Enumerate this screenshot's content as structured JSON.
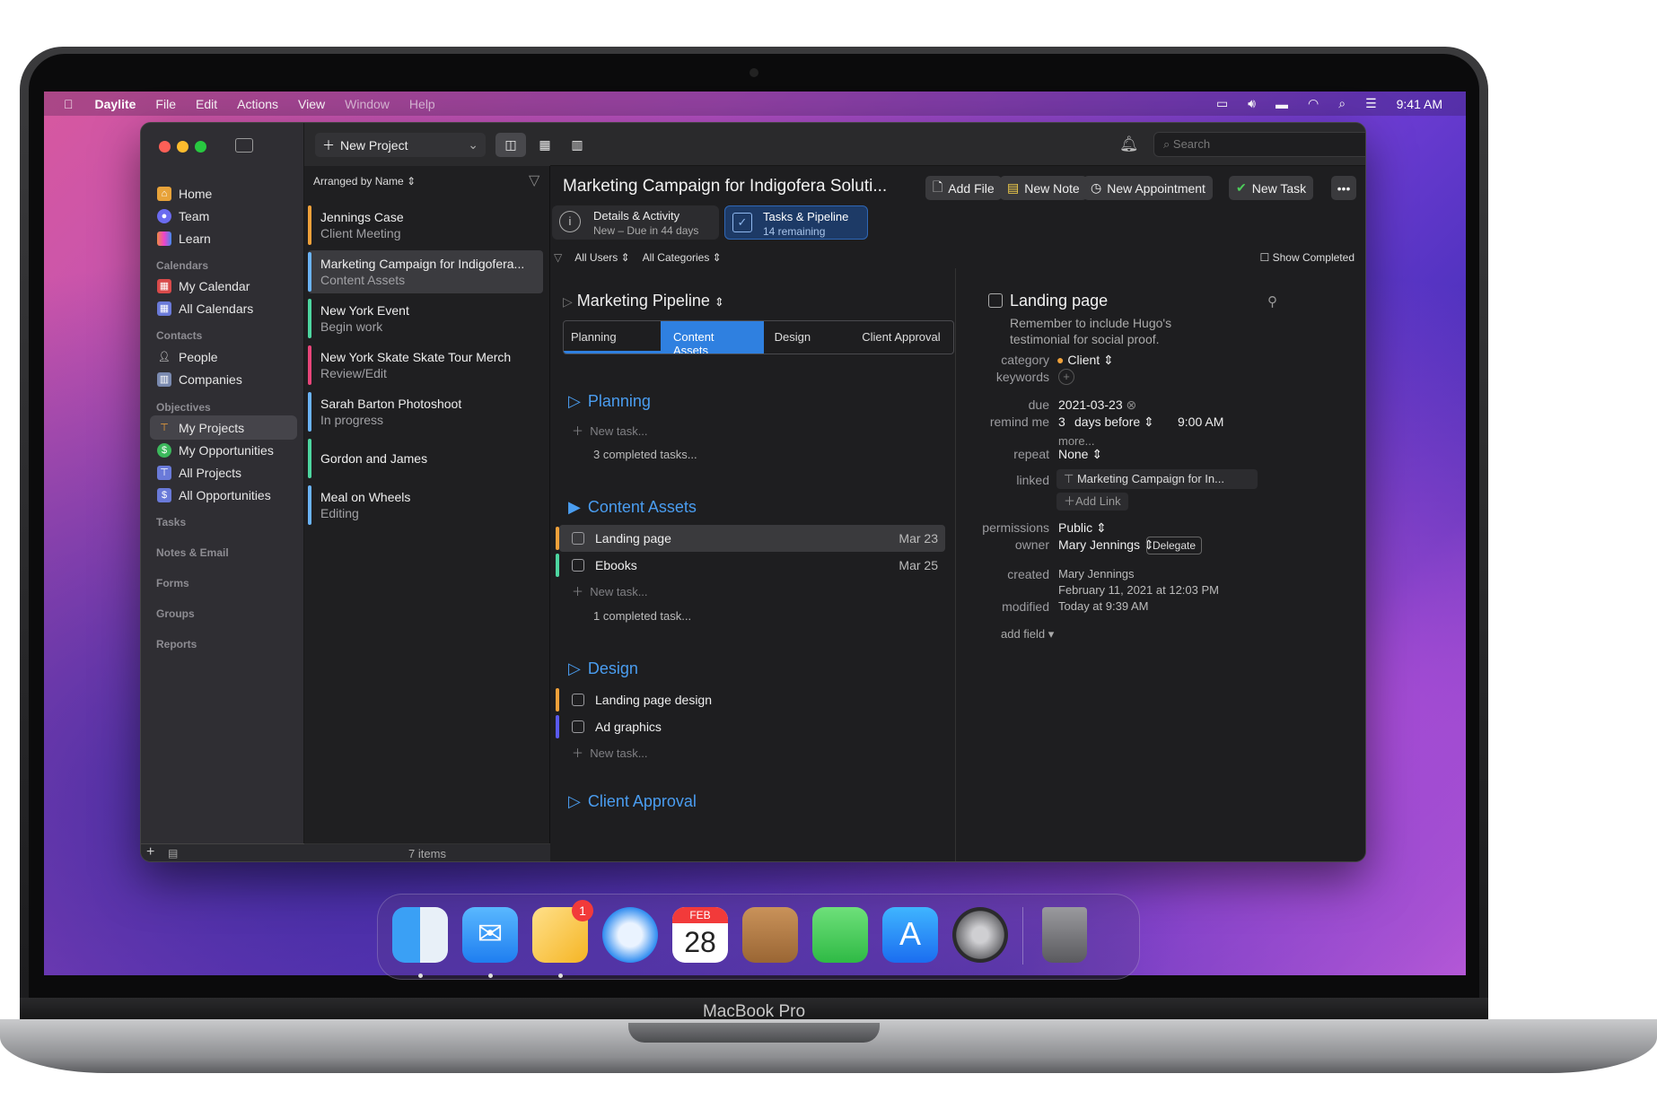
{
  "menubar": {
    "app": "Daylite",
    "items": [
      "File",
      "Edit",
      "Actions",
      "View",
      "Window",
      "Help"
    ],
    "clock": "9:41 AM"
  },
  "sidebar": {
    "main": [
      "Home",
      "Team",
      "Learn"
    ],
    "calendars_head": "Calendars",
    "calendars": [
      "My Calendar",
      "All Calendars"
    ],
    "contacts_head": "Contacts",
    "contacts": [
      "People",
      "Companies"
    ],
    "objectives_head": "Objectives",
    "objectives": [
      "My Projects",
      "My Opportunities",
      "All Projects",
      "All Opportunities"
    ],
    "sections": [
      "Tasks",
      "Notes & Email",
      "Forms",
      "Groups",
      "Reports"
    ]
  },
  "list": {
    "arrange": "Arranged by Name",
    "count": "7 items",
    "rows": [
      {
        "title": "Jennings Case",
        "sub": "Client Meeting",
        "color": "#f0a13a"
      },
      {
        "title": "Marketing Campaign for Indigofera...",
        "sub": "Content Assets",
        "color": "#6ab3f7"
      },
      {
        "title": "New York Event",
        "sub": "Begin work",
        "color": "#4dd6a0"
      },
      {
        "title": "New York Skate Skate Tour Merch",
        "sub": "Review/Edit",
        "color": "#e8457a"
      },
      {
        "title": "Sarah Barton Photoshoot",
        "sub": "In progress",
        "color": "#6ab3f7"
      },
      {
        "title": "Gordon and James",
        "sub": "",
        "color": "#4dd6a0"
      },
      {
        "title": "Meal on Wheels",
        "sub": "Editing",
        "color": "#6ab3f7"
      }
    ]
  },
  "toolbar": {
    "new_project": "New Project",
    "search_placeholder": "Search"
  },
  "header": {
    "title": "Marketing Campaign for Indigofera Soluti...",
    "add_file": "Add File",
    "new_note": "New Note",
    "new_appointment": "New Appointment",
    "new_task": "New Task",
    "tab1_title": "Details & Activity",
    "tab1_sub": "New – Due in 44 days",
    "tab2_title": "Tasks & Pipeline",
    "tab2_sub": "14 remaining",
    "filter_users": "All Users",
    "filter_categories": "All Categories",
    "show_completed": "Show Completed"
  },
  "pipeline": {
    "name": "Marketing Pipeline",
    "stages": [
      "Planning",
      "Content Assets",
      "Design",
      "Client Approval"
    ]
  },
  "sections": {
    "planning": {
      "title": "Planning",
      "new_task": "New task...",
      "completed": "3 completed tasks..."
    },
    "content": {
      "title": "Content Assets",
      "tasks": [
        {
          "name": "Landing page",
          "date": "Mar 23",
          "color": "#f0a13a"
        },
        {
          "name": "Ebooks",
          "date": "Mar 25",
          "color": "#4dd6a0"
        }
      ],
      "new_task": "New task...",
      "completed": "1 completed task..."
    },
    "design": {
      "title": "Design",
      "tasks": [
        {
          "name": "Landing page design",
          "color": "#f0a13a"
        },
        {
          "name": "Ad graphics",
          "color": "#5a5af0"
        }
      ],
      "new_task": "New task..."
    },
    "approval": {
      "title": "Client Approval"
    }
  },
  "detail": {
    "title": "Landing page",
    "note": "Remember to include Hugo's testimonial for social proof.",
    "labels": {
      "category": "category",
      "keywords": "keywords",
      "due": "due",
      "remind": "remind me",
      "more": "more...",
      "repeat": "repeat",
      "linked": "linked",
      "permissions": "permissions",
      "owner": "owner",
      "created": "created",
      "modified": "modified",
      "add_field": "add field"
    },
    "category": "Client",
    "due": "2021-03-23",
    "remind_num": "3",
    "remind_unit": "days before",
    "remind_time": "9:00 AM",
    "repeat": "None",
    "linked": "Marketing Campaign for In...",
    "add_link": "Add Link",
    "permissions": "Public",
    "owner": "Mary Jennings",
    "delegate": "Delegate",
    "created_by": "Mary Jennings",
    "created_at": "February 11, 2021 at 12:03 PM",
    "modified": "Today at 9:39 AM"
  },
  "dock": {
    "calendar_month": "FEB",
    "calendar_day": "28",
    "badge": "1"
  },
  "device": "MacBook Pro"
}
